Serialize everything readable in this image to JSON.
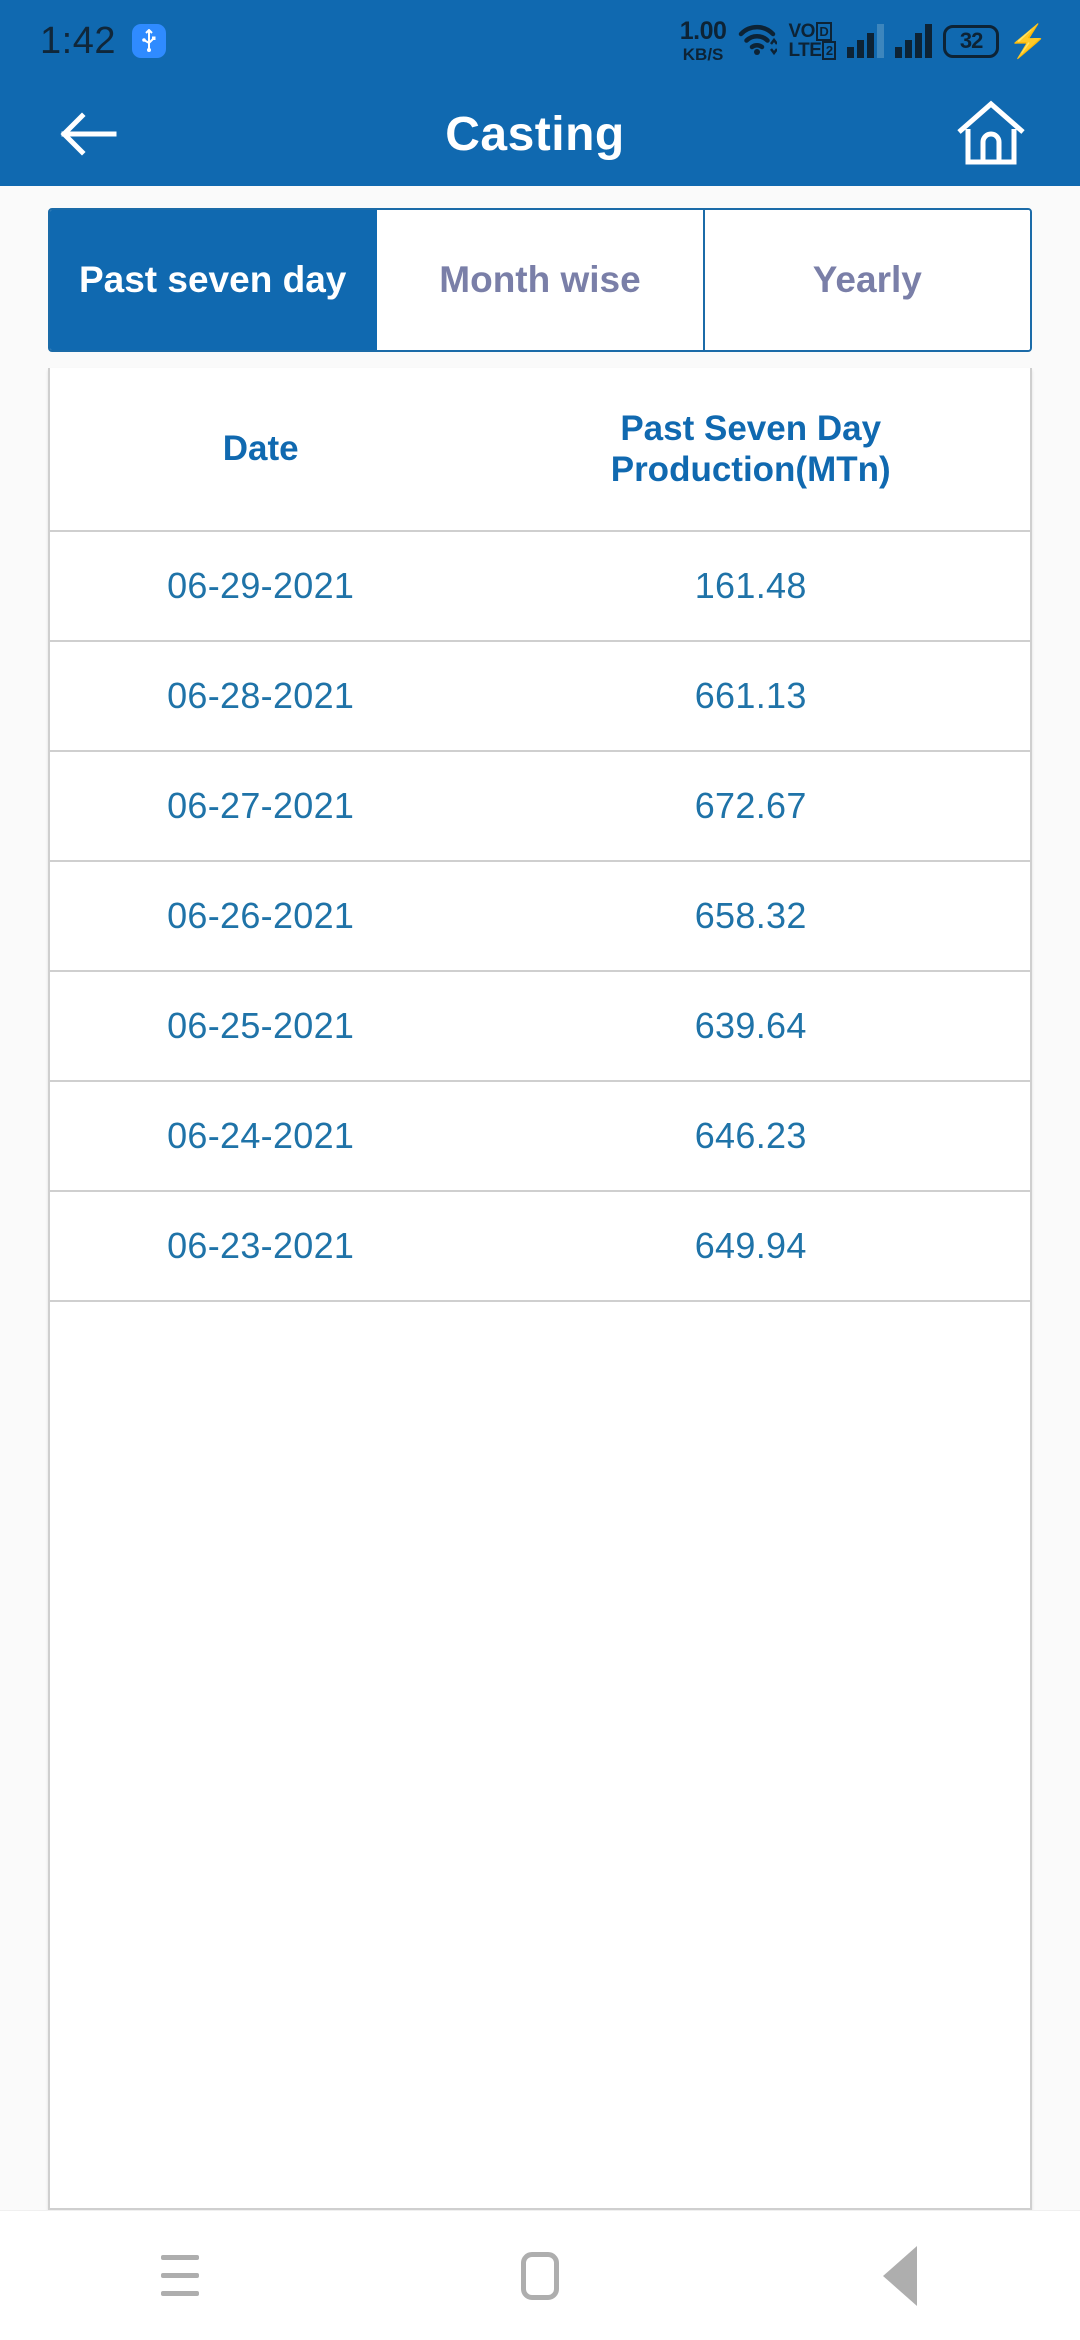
{
  "status_bar": {
    "clock": "1:42",
    "usb_icon": "usb-icon",
    "net_speed_value": "1.00",
    "net_speed_unit": "KB/S",
    "wifi_icon": "wifi-icon",
    "volte_line1": "VO",
    "volte_line2": "LTE",
    "volte_badge1": "D",
    "volte_badge2": "2",
    "signal_1_icon": "signal-bars-icon",
    "signal_2_icon": "signal-bars-icon",
    "battery_level": "32",
    "charging_icon": "charging-bolt-icon"
  },
  "app_bar": {
    "back_icon": "back-arrow-icon",
    "title": "Casting",
    "home_icon": "home-icon"
  },
  "tabs": [
    {
      "label": "Past seven day",
      "active": true
    },
    {
      "label": "Month wise",
      "active": false
    },
    {
      "label": "Yearly",
      "active": false
    }
  ],
  "table": {
    "headers": [
      "Date",
      "Past Seven Day Production(MTn)"
    ],
    "rows": [
      {
        "date": "06-29-2021",
        "production": "161.48"
      },
      {
        "date": "06-28-2021",
        "production": "661.13"
      },
      {
        "date": "06-27-2021",
        "production": "672.67"
      },
      {
        "date": "06-26-2021",
        "production": "658.32"
      },
      {
        "date": "06-25-2021",
        "production": "639.64"
      },
      {
        "date": "06-24-2021",
        "production": "646.23"
      },
      {
        "date": "06-23-2021",
        "production": "649.94"
      }
    ]
  },
  "nav_bar": {
    "recents_icon": "menu-recents-icon",
    "home_icon": "home-square-icon",
    "back_icon": "back-triangle-icon"
  },
  "colors": {
    "primary_blue": "#1069b0",
    "tab_inactive_text": "#7a7fa8",
    "table_text": "#1f73a8",
    "header_text": "#1069b0",
    "page_bg": "#fafafa"
  }
}
